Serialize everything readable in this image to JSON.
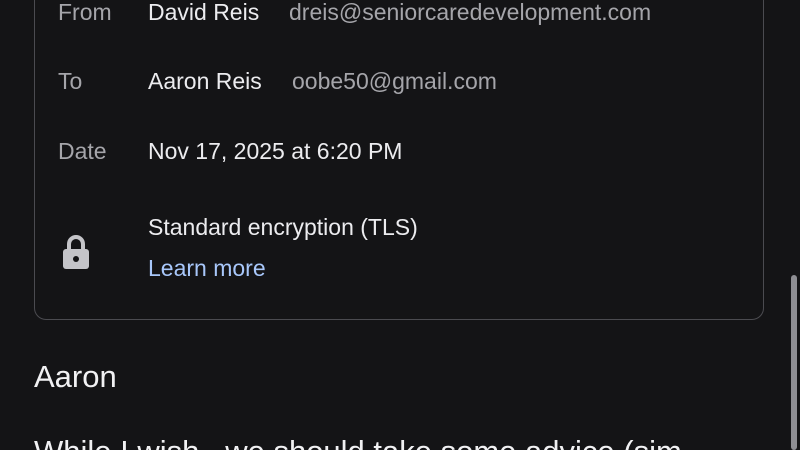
{
  "details": {
    "from": {
      "label": "From",
      "name": "David Reis",
      "email": "dreis@seniorcaredevelopment.com"
    },
    "to": {
      "label": "To",
      "name": "Aaron Reis",
      "email": "oobe50@gmail.com"
    },
    "date": {
      "label": "Date",
      "value": "Nov 17, 2025 at 6:20 PM"
    },
    "security": {
      "icon": "lock-icon",
      "text": "Standard encryption (TLS)",
      "link": "Learn more"
    }
  },
  "message": {
    "greeting": "Aaron",
    "body_visible": "While I wish...we should take some advice (sim"
  },
  "colors": {
    "background": "#141416",
    "primary_text": "#ececef",
    "secondary_text": "#a5a5aa",
    "link": "#a8c7fa",
    "card_border": "#4b4b50",
    "scrollbar": "#8e8e93"
  }
}
